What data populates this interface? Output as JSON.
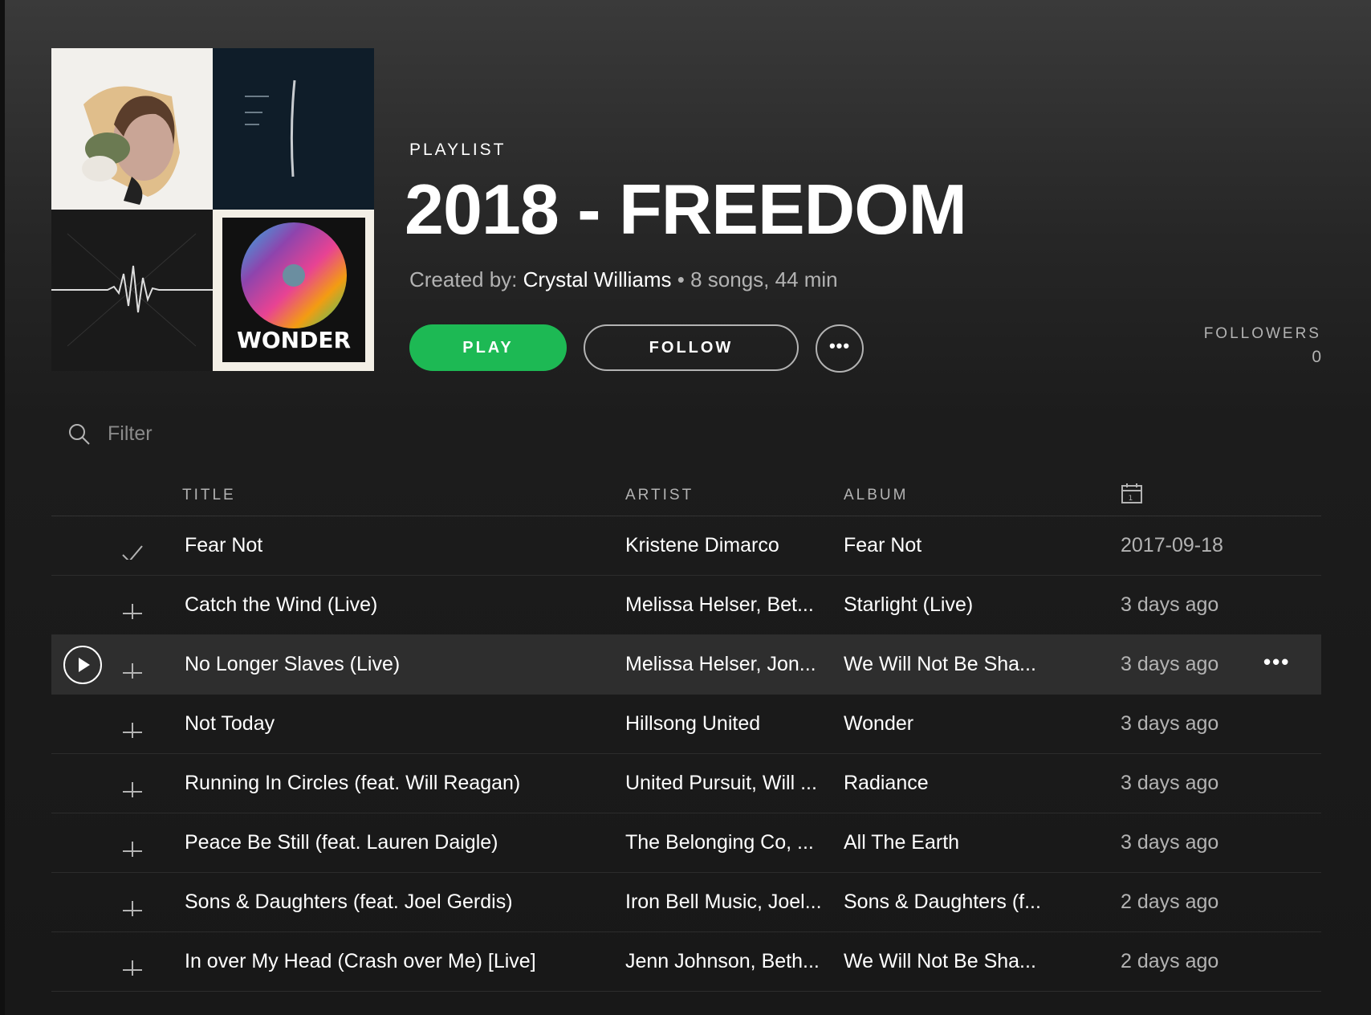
{
  "playlist": {
    "kind": "PLAYLIST",
    "title": "2018 - FREEDOM",
    "created_by_label": "Created by:",
    "owner": "Crystal Williams",
    "stats": "• 8 songs, 44 min",
    "cover_text": "WONDER"
  },
  "actions": {
    "play_label": "PLAY",
    "follow_label": "FOLLOW",
    "more_label": "•••"
  },
  "followers": {
    "label": "FOLLOWERS",
    "count": "0"
  },
  "filter": {
    "placeholder": "Filter"
  },
  "columns": {
    "title": "TITLE",
    "artist": "ARTIST",
    "album": "ALBUM"
  },
  "tracks": [
    {
      "title": "Fear Not",
      "artist": "Kristene Dimarco",
      "album": "Fear Not",
      "added": "2017-09-18",
      "status": "saved"
    },
    {
      "title": "Catch the Wind (Live)",
      "artist": "Melissa Helser, Bet...",
      "album": "Starlight (Live)",
      "added": "3 days ago",
      "status": "add"
    },
    {
      "title": "No Longer Slaves (Live)",
      "artist": "Melissa Helser, Jon...",
      "album": "We Will Not Be Sha...",
      "added": "3 days ago",
      "status": "add"
    },
    {
      "title": "Not Today",
      "artist": "Hillsong United",
      "album": "Wonder",
      "added": "3 days ago",
      "status": "add"
    },
    {
      "title": "Running In Circles (feat. Will Reagan)",
      "artist": "United Pursuit, Will ...",
      "album": "Radiance",
      "added": "3 days ago",
      "status": "add"
    },
    {
      "title": "Peace Be Still (feat. Lauren Daigle)",
      "artist": "The Belonging Co, ...",
      "album": "All The Earth",
      "added": "3 days ago",
      "status": "add"
    },
    {
      "title": "Sons & Daughters (feat. Joel Gerdis)",
      "artist": "Iron Bell Music, Joel...",
      "album": "Sons & Daughters (f...",
      "added": "2 days ago",
      "status": "add"
    },
    {
      "title": "In over My Head (Crash over Me) [Live]",
      "artist": "Jenn Johnson, Beth...",
      "album": "We Will Not Be Sha...",
      "added": "2 days ago",
      "status": "add"
    }
  ],
  "row_more_label": "•••",
  "colors": {
    "accent": "#1db954",
    "background": "#181818",
    "muted": "#b3b3b3"
  }
}
